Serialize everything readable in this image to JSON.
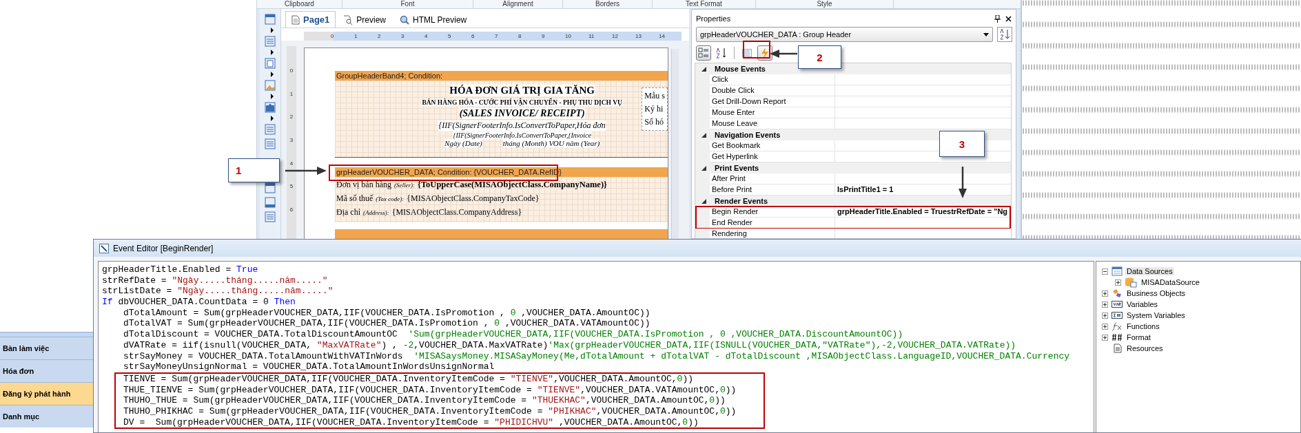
{
  "ribbon_groups": [
    "Clipboard",
    "Font",
    "Alignment",
    "Borders",
    "Text Format",
    "Style"
  ],
  "designer": {
    "tabs": [
      {
        "label": "Page1",
        "kind": "page",
        "selected": true
      },
      {
        "label": "Preview",
        "kind": "preview",
        "selected": false
      },
      {
        "label": "HTML Preview",
        "kind": "html",
        "selected": false
      }
    ],
    "ruler_marks": [
      "0",
      "1",
      "2",
      "3",
      "4",
      "5",
      "6",
      "7",
      "8",
      "9",
      "10",
      "11",
      "12",
      "13",
      "14"
    ],
    "vertical_ruler_marks": [
      "0",
      "1",
      "2",
      "3",
      "4",
      "5",
      "6"
    ],
    "title_band": {
      "header": "GroupHeaderBand4; Condition:",
      "lines": [
        {
          "kind": "title",
          "text": "HÓA ĐƠN GIÁ TRỊ GIA TĂNG"
        },
        {
          "kind": "subtitle",
          "text": "BÁN HÀNG HÓA - CƯỚC PHÍ VẬN CHUYỂN - PHỤ THU DỊCH VỤ"
        },
        {
          "kind": "english",
          "text": "(SALES INVOICE/ RECEIPT)"
        },
        {
          "kind": "expression",
          "text": "{IIF(SignerFooterInfo.IsConvertToPaper,Hóa đơn"
        },
        {
          "kind": "expression_small",
          "text": "{IIF(SignerFooterInfo.IsConvertToPaper,{Invoice"
        }
      ],
      "date_parts": [
        "Ngày (Date)",
        "tháng (Month) VOU  năm (Year)"
      ],
      "side_box": [
        "Mẫu s",
        "Ký hi",
        "Số hó"
      ]
    },
    "group_band": {
      "header": "grpHeaderVOUCHER_DATA; Condition: {VOUCHER_DATA.RefID}",
      "rows": [
        {
          "label": "Đơn vị bán hàng",
          "label_en": "(Seller):",
          "value": "{ToUpperCase(MISAObjectClass.CompanyName)}",
          "bold": true
        },
        {
          "label": "Mã số thuế",
          "label_en": "(Tax code):",
          "value": "{MISAObjectClass.CompanyTaxCode}",
          "bold": false
        },
        {
          "label": "Địa chỉ",
          "label_en": "(Address):",
          "value": "{MISAObjectClass.CompanyAddress}",
          "bold": false
        }
      ]
    }
  },
  "callouts": [
    "1",
    "2",
    "3"
  ],
  "properties": {
    "title": "Properties",
    "object_selector": "grpHeaderVOUCHER_DATA : Group Header",
    "view_buttons": [
      {
        "kind": "categorized",
        "selected": true
      },
      {
        "kind": "alphabetical",
        "selected": false
      },
      {
        "kind": "properties",
        "selected": false
      },
      {
        "kind": "events",
        "selected": true
      }
    ],
    "groups": [
      {
        "name": "Mouse Events",
        "expanded": true,
        "events": [
          {
            "name": "Click",
            "boxed": false
          },
          {
            "name": "Double Click",
            "boxed": false
          },
          {
            "name": "Get Drill-Down Report",
            "boxed": false
          },
          {
            "name": "Mouse Enter",
            "boxed": false
          },
          {
            "name": "Mouse Leave",
            "boxed": false
          }
        ]
      },
      {
        "name": "Navigation Events",
        "expanded": true,
        "events": [
          {
            "name": "Get Bookmark",
            "boxed": false
          },
          {
            "name": "Get Hyperlink",
            "boxed": false
          }
        ]
      },
      {
        "name": "Print Events",
        "expanded": true,
        "events": [
          {
            "name": "After Print",
            "boxed": false
          },
          {
            "name": "Before Print",
            "value": "IsPrintTitle1 = 1",
            "boxed": false
          }
        ]
      },
      {
        "name": "Render Events",
        "expanded": true,
        "events": [
          {
            "name": "Begin Render",
            "value": "grpHeaderTitle.Enabled = TruestrRefDate = \"Ng",
            "boxed": true
          },
          {
            "name": "End Render",
            "boxed": true
          },
          {
            "name": "Rendering",
            "boxed": false
          }
        ]
      }
    ]
  },
  "sidebar": {
    "items": [
      {
        "label": "Bàn làm việc",
        "selected": false
      },
      {
        "label": "Hóa đơn",
        "selected": false
      },
      {
        "label": "Đăng ký phát hành",
        "selected": true
      },
      {
        "label": "Danh mục",
        "selected": false
      }
    ]
  },
  "event_editor": {
    "title": "Event Editor [BeginRender]",
    "code": [
      {
        "tokens": [
          {
            "kind": "plain",
            "text": "grpHeaderTitle.Enabled = "
          },
          {
            "kind": "keyword",
            "text": "True"
          }
        ]
      },
      {
        "tokens": [
          {
            "kind": "plain",
            "text": "strRefDate = "
          },
          {
            "kind": "string",
            "text": "\"Ngày.....tháng.....năm.....\""
          }
        ]
      },
      {
        "tokens": [
          {
            "kind": "plain",
            "text": "strListDate = "
          },
          {
            "kind": "string",
            "text": "\"Ngày.....tháng.....năm.....\""
          }
        ]
      },
      {
        "tokens": [
          {
            "kind": "keyword",
            "text": "If"
          },
          {
            "kind": "plain",
            "text": " dbVOUCHER_DATA.CountData = 0 "
          },
          {
            "kind": "keyword",
            "text": "Then"
          }
        ],
        "children": [
          {
            "boxed": false,
            "tokens": [
              {
                "kind": "plain",
                "text": "dTotalAmount = Sum(grpHeaderVOUCHER_DATA,IIF(VOUCHER_DATA.IsPromotion , "
              },
              {
                "kind": "number",
                "text": "0"
              },
              {
                "kind": "plain",
                "text": " ,VOUCHER_DATA.AmountOC))"
              }
            ]
          },
          {
            "boxed": false,
            "tokens": [
              {
                "kind": "plain",
                "text": "dTotalVAT = Sum(grpHeaderVOUCHER_DATA,IIF(VOUCHER_DATA.IsPromotion , "
              },
              {
                "kind": "number",
                "text": "0"
              },
              {
                "kind": "plain",
                "text": " ,VOUCHER_DATA.VATAmountOC))"
              }
            ]
          },
          {
            "boxed": false,
            "tokens": [
              {
                "kind": "plain",
                "text": "dTotalDiscount = VOUCHER_DATA.TotalDiscountAmountOC  "
              },
              {
                "kind": "comment",
                "text": "'Sum(grpHeaderVOUCHER_DATA,IIF(VOUCHER_DATA.IsPromotion , 0 ,VOUCHER_DATA.DiscountAmountOC))"
              }
            ]
          },
          {
            "boxed": false,
            "tokens": [
              {
                "kind": "plain",
                "text": "dVATRate = iif(isnull(VOUCHER_DATA, "
              },
              {
                "kind": "string",
                "text": "\"MaxVATRate\""
              },
              {
                "kind": "plain",
                "text": ") , "
              },
              {
                "kind": "number",
                "text": "-2"
              },
              {
                "kind": "plain",
                "text": ",VOUCHER_DATA.MaxVATRate)"
              },
              {
                "kind": "comment",
                "text": "'Max(grpHeaderVOUCHER_DATA,IIF(ISNULL(VOUCHER_DATA,\"VATRate\"),-2,VOUCHER_DATA.VATRate))"
              }
            ]
          },
          {
            "boxed": false,
            "tokens": [
              {
                "kind": "plain",
                "text": "strSayMoney = VOUCHER_DATA.TotalAmountWithVATInWords  "
              },
              {
                "kind": "comment",
                "text": "'MISASaysMoney.MISASayMoney(Me,dTotalAmount + dTotalVAT - dTotalDiscount ,MISAObjectClass.LanguageID,VOUCHER_DATA.Currency"
              }
            ]
          },
          {
            "boxed": false,
            "tokens": [
              {
                "kind": "plain",
                "text": "strSayMoneyUnsignNormal = VOUCHER_DATA.TotalAmountInWordsUnsignNormal"
              }
            ]
          },
          {
            "boxed": true,
            "tokens": [
              {
                "kind": "plain",
                "text": "TIENVE = Sum(grpHeaderVOUCHER_DATA,IIF(VOUCHER_DATA.InventoryItemCode = "
              },
              {
                "kind": "string",
                "text": "\"TIENVE\""
              },
              {
                "kind": "plain",
                "text": ",VOUCHER_DATA.AmountOC,"
              },
              {
                "kind": "number",
                "text": "0"
              },
              {
                "kind": "plain",
                "text": "))"
              }
            ]
          },
          {
            "boxed": true,
            "tokens": [
              {
                "kind": "plain",
                "text": "THUE_TIENVE = Sum(grpHeaderVOUCHER_DATA,IIF(VOUCHER_DATA.InventoryItemCode = "
              },
              {
                "kind": "string",
                "text": "\"TIENVE\""
              },
              {
                "kind": "plain",
                "text": ",VOUCHER_DATA.VATAmountOC,"
              },
              {
                "kind": "number",
                "text": "0"
              },
              {
                "kind": "plain",
                "text": "))"
              }
            ]
          },
          {
            "boxed": true,
            "tokens": [
              {
                "kind": "plain",
                "text": "THUHO_THUE = Sum(grpHeaderVOUCHER_DATA,IIF(VOUCHER_DATA.InventoryItemCode = "
              },
              {
                "kind": "string",
                "text": "\"THUEKHAC\""
              },
              {
                "kind": "plain",
                "text": ",VOUCHER_DATA.AmountOC,"
              },
              {
                "kind": "number",
                "text": "0"
              },
              {
                "kind": "plain",
                "text": "))"
              }
            ]
          },
          {
            "boxed": true,
            "tokens": [
              {
                "kind": "plain",
                "text": "THUHO_PHIKHAC = Sum(grpHeaderVOUCHER_DATA,IIF(VOUCHER_DATA.InventoryItemCode = "
              },
              {
                "kind": "string",
                "text": "\"PHIKHAC\""
              },
              {
                "kind": "plain",
                "text": ",VOUCHER_DATA.AmountOC,"
              },
              {
                "kind": "number",
                "text": "0"
              },
              {
                "kind": "plain",
                "text": "))"
              }
            ]
          },
          {
            "boxed": true,
            "tokens": [
              {
                "kind": "plain",
                "text": "DV =  Sum(grpHeaderVOUCHER_DATA,IIF(VOUCHER_DATA.InventoryItemCode = "
              },
              {
                "kind": "string",
                "text": "\"PHIDICHVU\""
              },
              {
                "kind": "plain",
                "text": " ,VOUCHER_DATA.AmountOC,"
              },
              {
                "kind": "number",
                "text": "0"
              },
              {
                "kind": "plain",
                "text": "))"
              }
            ]
          }
        ]
      }
    ],
    "tree": [
      {
        "label": "Data Sources",
        "kind": "datasources",
        "expanded": true,
        "selected": true,
        "children": [
          {
            "label": "MISADataSource",
            "kind": "database",
            "expanded": false,
            "selected": false
          }
        ]
      },
      {
        "label": "Business Objects",
        "kind": "objects",
        "expanded": false,
        "selected": false
      },
      {
        "label": "Variables",
        "kind": "variables",
        "expanded": false,
        "selected": false
      },
      {
        "label": "System Variables",
        "kind": "sysvars",
        "expanded": false,
        "selected": false
      },
      {
        "label": "Functions",
        "kind": "functions",
        "expanded": false,
        "selected": false
      },
      {
        "label": "Format",
        "kind": "format",
        "expanded": false,
        "selected": false
      },
      {
        "label": "Resources",
        "kind": "resources",
        "selected": false
      }
    ]
  }
}
